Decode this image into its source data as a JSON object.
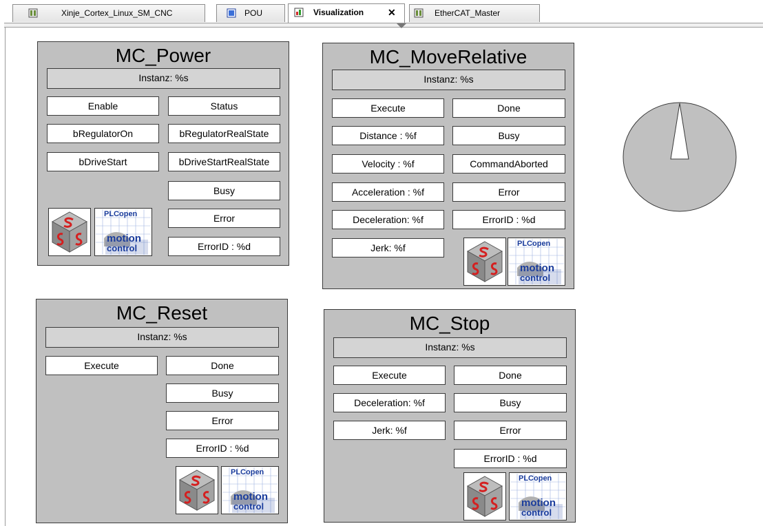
{
  "tabs": [
    {
      "label": "Xinje_Cortex_Linux_SM_CNC",
      "icon": "device-icon",
      "active": false
    },
    {
      "label": "POU",
      "icon": "pou-icon",
      "active": false
    },
    {
      "label": "Visualization",
      "icon": "visualization-icon",
      "active": true,
      "close": "✕"
    },
    {
      "label": "EtherCAT_Master",
      "icon": "device-icon",
      "active": false
    }
  ],
  "blocks": {
    "power": {
      "title": "MC_Power",
      "instance": "Instanz: %s",
      "inputs": [
        "Enable",
        "bRegulatorOn",
        "bDriveStart"
      ],
      "outputs": [
        "Status",
        "bRegulatorRealState",
        "bDriveStartRealState",
        "Busy",
        "Error",
        "ErrorID : %d"
      ]
    },
    "move_relative": {
      "title": "MC_MoveRelative",
      "instance": "Instanz: %s",
      "inputs": [
        "Execute",
        "Distance : %f",
        "Velocity : %f",
        "Acceleration : %f",
        "Deceleration: %f",
        "Jerk: %f"
      ],
      "outputs": [
        "Done",
        "Busy",
        "CommandAborted",
        "Error",
        "ErrorID : %d"
      ]
    },
    "reset": {
      "title": "MC_Reset",
      "instance": "Instanz: %s",
      "inputs": [
        "Execute"
      ],
      "outputs": [
        "Done",
        "Busy",
        "Error",
        "ErrorID : %d"
      ]
    },
    "stop": {
      "title": "MC_Stop",
      "instance": "Instanz: %s",
      "inputs": [
        "Execute",
        "Deceleration: %f",
        "Jerk: %f"
      ],
      "outputs": [
        "Done",
        "Busy",
        "Error",
        "ErrorID : %d"
      ]
    }
  },
  "logo": {
    "plcopen_line1": "PLCopen",
    "plcopen_line2": "motion",
    "plcopen_line3": "control"
  },
  "colors": {
    "panel": "#c0c0c0",
    "logo_red": "#d42020",
    "plcopen_blue": "#1a3c9c"
  }
}
